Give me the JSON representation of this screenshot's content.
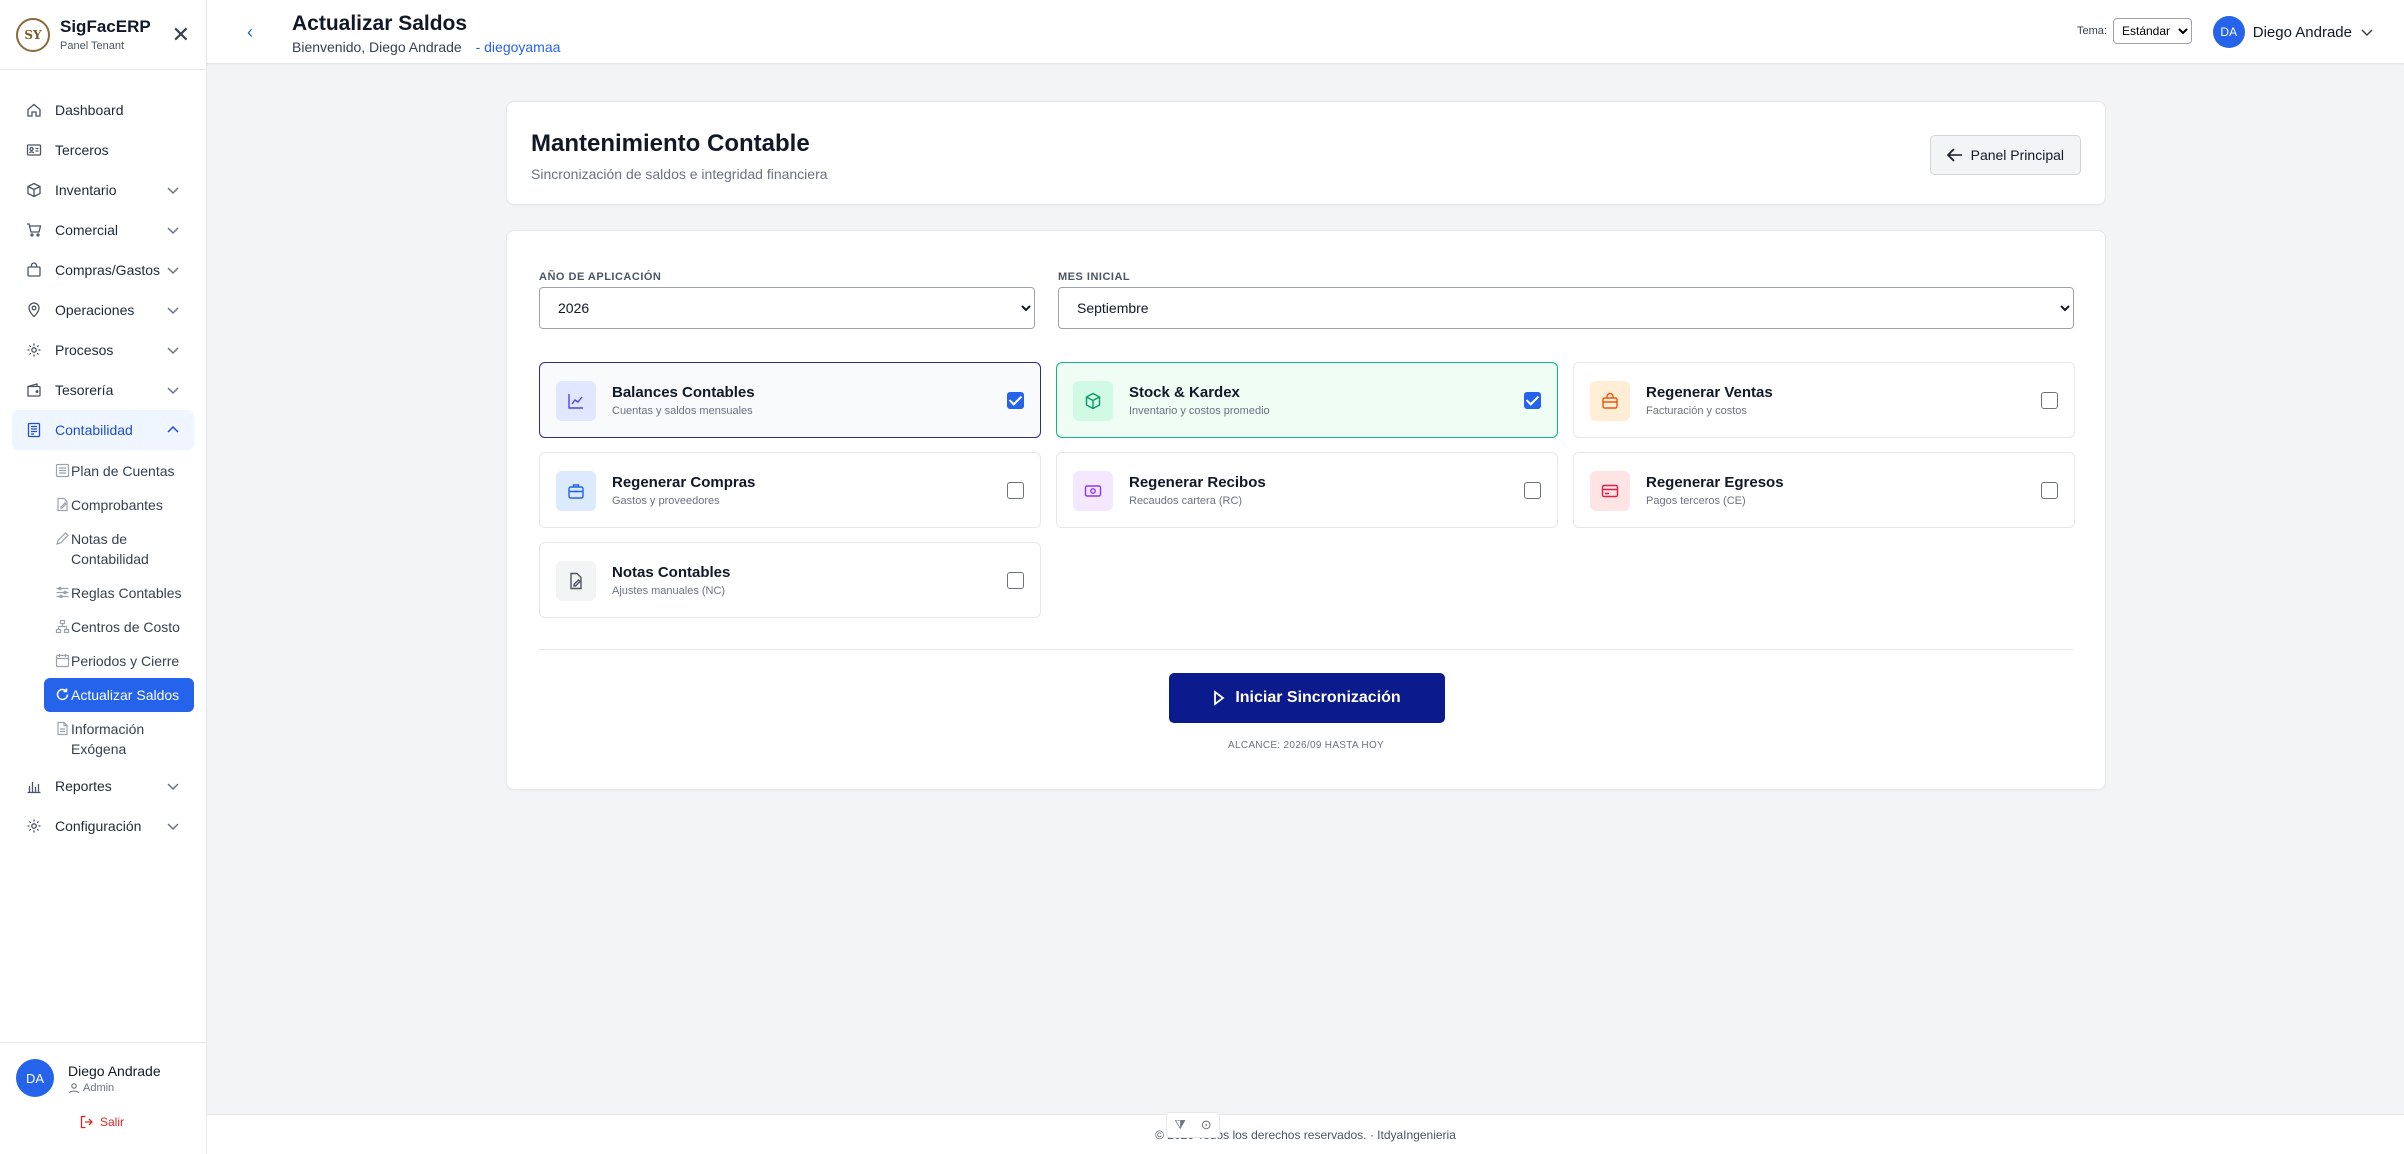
{
  "brand": {
    "name": "SigFacERP",
    "subtitle": "Panel Tenant",
    "logo_text": "SY"
  },
  "sidebar": {
    "items": [
      {
        "label": "Dashboard",
        "icon": "home-icon"
      },
      {
        "label": "Terceros",
        "icon": "id-card-icon"
      },
      {
        "label": "Inventario",
        "icon": "box-icon"
      },
      {
        "label": "Comercial",
        "icon": "cart-icon"
      },
      {
        "label": "Compras/Gastos",
        "icon": "bag-icon"
      },
      {
        "label": "Operaciones",
        "icon": "location-pin-icon"
      },
      {
        "label": "Procesos",
        "icon": "gear-icon"
      },
      {
        "label": "Tesorería",
        "icon": "wallet-icon"
      },
      {
        "label": "Contabilidad",
        "icon": "ledger-icon"
      },
      {
        "label": "Reportes",
        "icon": "bar-chart-icon"
      },
      {
        "label": "Configuración",
        "icon": "gear-icon"
      }
    ],
    "contabilidad_sub": [
      {
        "label": "Plan de Cuentas"
      },
      {
        "label": "Comprobantes"
      },
      {
        "label": "Notas de Contabilidad"
      },
      {
        "label": "Reglas Contables"
      },
      {
        "label": "Centros de Costo"
      },
      {
        "label": "Periodos y Cierre"
      },
      {
        "label": "Actualizar Saldos"
      },
      {
        "label": "Información Exógena"
      }
    ]
  },
  "user": {
    "initials": "DA",
    "name": "Diego Andrade",
    "role": "Admin",
    "logout": "Salir"
  },
  "header": {
    "title": "Actualizar Saldos",
    "welcome": "Bienvenido, Diego Andrade",
    "tenant": "- diegoyamaa",
    "theme_label": "Tema:",
    "theme_value": "Estándar"
  },
  "main": {
    "title": "Mantenimiento Contable",
    "subtitle": "Sincronización de saldos e integridad financiera",
    "panel_button": "Panel Principal",
    "year_label": "AÑO DE APLICACIÓN",
    "year_value": "2026",
    "month_label": "MES INICIAL",
    "month_value": "Septiembre",
    "options": [
      {
        "title": "Balances Contables",
        "desc": "Cuentas y saldos mensuales",
        "checked": true,
        "color": "#4f46e5"
      },
      {
        "title": "Stock & Kardex",
        "desc": "Inventario y costos promedio",
        "checked": true,
        "color": "#059669"
      },
      {
        "title": "Regenerar Ventas",
        "desc": "Facturación y costos",
        "checked": false,
        "color": "#ea580c"
      },
      {
        "title": "Regenerar Compras",
        "desc": "Gastos y proveedores",
        "checked": false,
        "color": "#2563eb"
      },
      {
        "title": "Regenerar Recibos",
        "desc": "Recaudos cartera (RC)",
        "checked": false,
        "color": "#9333ea"
      },
      {
        "title": "Regenerar Egresos",
        "desc": "Pagos terceros (CE)",
        "checked": false,
        "color": "#e11d48"
      },
      {
        "title": "Notas Contables",
        "desc": "Ajustes manuales (NC)",
        "checked": false,
        "color": "#4b5563"
      }
    ],
    "sync_button": "Iniciar Sincronización",
    "scope": "ALCANCE: 2026/09 HASTA HOY"
  },
  "footer": {
    "text": "© 2026 Todos los derechos reservados. · ItdyaIngenieria"
  }
}
